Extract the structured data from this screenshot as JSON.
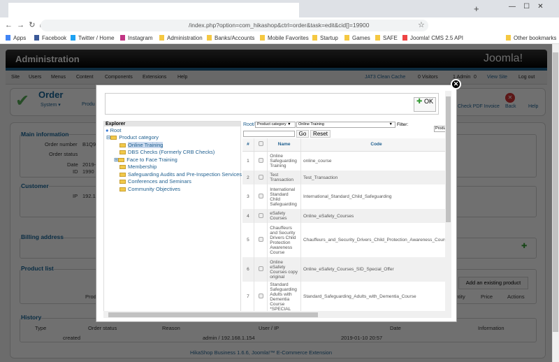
{
  "browser": {
    "url": "/index.php?option=com_hikashop&ctrl=order&task=edit&cid[]=19900",
    "bookmarks": [
      "Apps",
      "Facebook",
      "Twitter / Home",
      "Instagram",
      "Administration",
      "Banks/Accounts",
      "Mobile Favorites",
      "Startup",
      "Games",
      "SAFE",
      "Joomla! CMS 2.5 API",
      "Other bookmarks"
    ]
  },
  "header": {
    "title": "Administration",
    "logo": "Joomla!"
  },
  "menu": [
    "Site",
    "Users",
    "Menus",
    "Content",
    "Components",
    "Extensions",
    "Help"
  ],
  "status": [
    "JAT3 Clean Cache",
    "0 Visitors",
    "1 Admin",
    "0",
    "View Site",
    "Log out"
  ],
  "toolbar": {
    "title": "Order",
    "system": "System ▾",
    "products": "Produ",
    "check_pdf": "Check PDF Invoice",
    "back": "Back",
    "help": "Help"
  },
  "main_info": {
    "legend": "Main information",
    "order_number_label": "Order number",
    "order_number": "B1Q9",
    "order_status_label": "Order status",
    "date_label": "Date",
    "date": "2019-",
    "id_label": "ID",
    "id": "1990"
  },
  "customer": {
    "legend": "Customer",
    "ip_label": "IP",
    "ip": "192.1"
  },
  "billing": {
    "legend": "Billing address"
  },
  "products": {
    "legend": "Product list",
    "add_existing": "Add an existing product",
    "col_product": "Prod",
    "col_quantity": "ntity",
    "col_price": "Price",
    "col_actions": "Actions"
  },
  "history": {
    "legend": "History",
    "columns": [
      "Type",
      "Order status",
      "Reason",
      "User / IP",
      "Date",
      "Information"
    ],
    "row": [
      "",
      "created",
      "",
      "admin / 192.168.1.154",
      "2019-01-10 20:57",
      ""
    ]
  },
  "footer": "HikaShop Business 1.6.6, Joomla!™ E-Commerce Extension",
  "modal": {
    "ok": "OK",
    "explorer": "Explorer",
    "root": "Root",
    "tree": [
      "Product category",
      "Online Training",
      "DBS Checks (Formerly CRB Checks)",
      "Face to Face Training",
      "Membership",
      "Safeguarding Audits and Pre-Inspection Services",
      "Conferences and Seminars",
      "Community Objectives"
    ],
    "breadcrumb_root": "Root/",
    "type_select": "Product category ▼",
    "category_select": "Online Training",
    "filter_label": "Filter:",
    "filter_select": "Produ",
    "search_value": "",
    "go": "Go",
    "reset": "Reset",
    "columns": [
      "#",
      "Name",
      "Code"
    ],
    "rows": [
      {
        "n": "1",
        "name": "Online Safeguarding Training",
        "code": "online_course"
      },
      {
        "n": "2",
        "name": "Test Transaction",
        "code": "Test_Transaction"
      },
      {
        "n": "3",
        "name": "International Standard Child Safeguarding",
        "code": "International_Standard_Child_Safeguarding"
      },
      {
        "n": "4",
        "name": "eSafety Courses",
        "code": "Online_eSafety_Courses"
      },
      {
        "n": "5",
        "name": "Chauffeurs and Security Drivers Child Protection Awareness Course",
        "code": "Chauffeurs_and_Security_Drivers_Child_Protection_Awareness_Course"
      },
      {
        "n": "6",
        "name": "Online eSafety Courses copy original",
        "code": "Online_eSafety_Courses_SID_Special_Offer"
      },
      {
        "n": "7",
        "name": "Standard Safeguarding Adults with Dementia Course *SPECIAL",
        "code": "Standard_Safeguarding_Adults_with_Dementia_Course"
      }
    ]
  }
}
